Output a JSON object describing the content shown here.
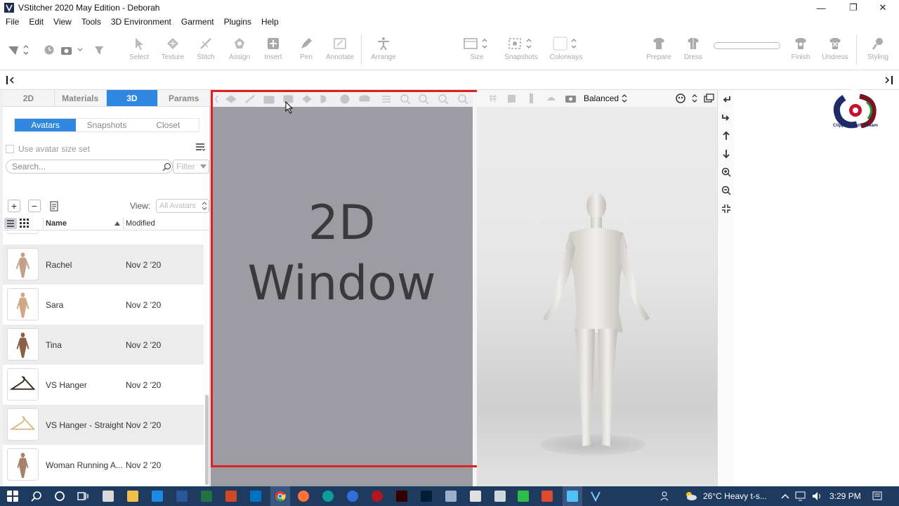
{
  "window": {
    "title": "VStitcher 2020 May Edition - Deborah",
    "controls": [
      "—",
      "❐",
      "✕"
    ]
  },
  "menu": [
    "File",
    "Edit",
    "View",
    "Tools",
    "3D Environment",
    "Garment",
    "Plugins",
    "Help"
  ],
  "toolbar": {
    "tools": [
      {
        "label": "Select",
        "icon": "cursor-icon"
      },
      {
        "label": "Texture",
        "icon": "texture-icon"
      },
      {
        "label": "Stitch",
        "icon": "stitch-icon"
      },
      {
        "label": "Assign",
        "icon": "assign-icon"
      },
      {
        "label": "Insert",
        "icon": "insert-icon"
      },
      {
        "label": "Pen",
        "icon": "pen-icon"
      },
      {
        "label": "Annotate",
        "icon": "annotate-icon"
      },
      {
        "label": "Arrange",
        "icon": "arrange-icon"
      },
      {
        "label": "Size",
        "icon": "size-icon"
      },
      {
        "label": "Snapshots",
        "icon": "snapshot-icon"
      },
      {
        "label": "Colorways",
        "icon": "colorway-icon"
      },
      {
        "label": "Prepare",
        "icon": "prepare-icon"
      },
      {
        "label": "Dress",
        "icon": "dress-icon"
      },
      {
        "label": "Finish",
        "icon": "finish-icon"
      },
      {
        "label": "Undress",
        "icon": "undress-icon"
      },
      {
        "label": "Styling",
        "icon": "styling-icon"
      }
    ]
  },
  "panel": {
    "tabs": [
      "2D",
      "Materials",
      "3D",
      "Params"
    ],
    "active_tab": "3D",
    "subtabs": [
      "Avatars",
      "Snapshots",
      "Closet"
    ],
    "active_subtab": "Avatars",
    "checkbox_label": "Use avatar size set",
    "search_placeholder": "Search...",
    "filter_label": "Filter",
    "view_label": "View:",
    "view_value": "All Avatars",
    "columns": {
      "name": "Name",
      "modified": "Modified"
    },
    "items": [
      {
        "name": "Rachel",
        "modified": "Nov 2 '20"
      },
      {
        "name": "Sara",
        "modified": "Nov 2 '20"
      },
      {
        "name": "Tina",
        "modified": "Nov 2 '20"
      },
      {
        "name": "VS Hanger",
        "modified": "Nov 2 '20"
      },
      {
        "name": "VS Hanger - Straight",
        "modified": "Nov 2 '20"
      },
      {
        "name": "Woman Running A...",
        "modified": "Nov 2 '20"
      }
    ]
  },
  "window2d": {
    "line1": "2D",
    "line2": "Window"
  },
  "window3d": {
    "render_mode": "Balanced"
  },
  "logo": {
    "text": "Clipping Path Dream"
  },
  "taskbar": {
    "weather": "26°C  Heavy t-s...",
    "time": "3:29 PM",
    "colors": {
      "background": "#1f3a5f",
      "accent": "#2f87e0",
      "highlight": "#e02020"
    }
  }
}
